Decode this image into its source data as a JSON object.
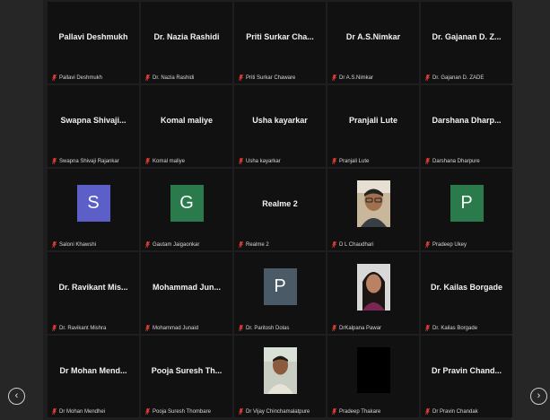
{
  "colors": {
    "tile_bg": "#111111",
    "mic_muted": "#e8402f",
    "avatar_S": "#5b5fc7",
    "avatar_G": "#2b7a4b",
    "avatar_P1": "#2b7a4b",
    "avatar_P2": "#4a5a66"
  },
  "navigation": {
    "prev_icon": "chevron-left-icon",
    "next_icon": "chevron-right-icon"
  },
  "participants": [
    {
      "display": "Pallavi Deshmukh",
      "label": "Pallavi Deshmukh",
      "type": "name"
    },
    {
      "display": "Dr. Nazia Rashidi",
      "label": "Dr. Nazia Rashidi",
      "type": "name"
    },
    {
      "display": "Priti Surkar Cha...",
      "label": "Priti Surkar Chaware",
      "type": "name"
    },
    {
      "display": "Dr A.S.Nimkar",
      "label": "Dr A.S.Nimkar",
      "type": "name"
    },
    {
      "display": "Dr. Gajanan D. Z...",
      "label": "Dr. Gajanan D. ZADE",
      "type": "name"
    },
    {
      "display": "Swapna Shivaji...",
      "label": "Swapna Shivaji Rajankar",
      "type": "name"
    },
    {
      "display": "Komal maliye",
      "label": "Komal maliye",
      "type": "name"
    },
    {
      "display": "Usha kayarkar",
      "label": "Usha kayarkar",
      "type": "name"
    },
    {
      "display": "Pranjali Lute",
      "label": "Pranjali Lute",
      "type": "name"
    },
    {
      "display": "Darshana Dharp...",
      "label": "Darshana Dharpure",
      "type": "name"
    },
    {
      "display": "S",
      "label": "Saloni Khawshi",
      "type": "letter",
      "color": "#5b5fc7"
    },
    {
      "display": "G",
      "label": "Gautam Jaigaonkar",
      "type": "letter",
      "color": "#2b7a4b"
    },
    {
      "display": "Realme 2",
      "label": "Realme 2",
      "type": "name"
    },
    {
      "display": "",
      "label": "D L Chaudhari",
      "type": "photo",
      "photo": "man-glasses"
    },
    {
      "display": "P",
      "label": "Pradeep Ukey",
      "type": "letter",
      "color": "#2b7a4b"
    },
    {
      "display": "Dr. Ravikant Mis...",
      "label": "Dr. Ravikant Mishra",
      "type": "name"
    },
    {
      "display": "Mohammad Jun...",
      "label": "Mohammad Junaid",
      "type": "name"
    },
    {
      "display": "P",
      "label": "Dr. Paritosh Dolas",
      "type": "letter",
      "color": "#4a5a66"
    },
    {
      "display": "",
      "label": "DrKalpana Pawar",
      "type": "photo",
      "photo": "woman"
    },
    {
      "display": "Dr. Kailas Borgade",
      "label": "Dr. Kailas Borgade",
      "type": "name"
    },
    {
      "display": "Dr Mohan Mend...",
      "label": "Dr Mohan Mendhei",
      "type": "name"
    },
    {
      "display": "Pooja Suresh Th...",
      "label": "Pooja Suresh Thombare",
      "type": "name"
    },
    {
      "display": "",
      "label": "Dr Vijay Chinchamalatpure",
      "type": "photo",
      "photo": "man"
    },
    {
      "display": "",
      "label": "Pradeep Thakare",
      "type": "black"
    },
    {
      "display": "Dr Pravin Chand...",
      "label": "Dr Pravin Chandak",
      "type": "name"
    }
  ]
}
